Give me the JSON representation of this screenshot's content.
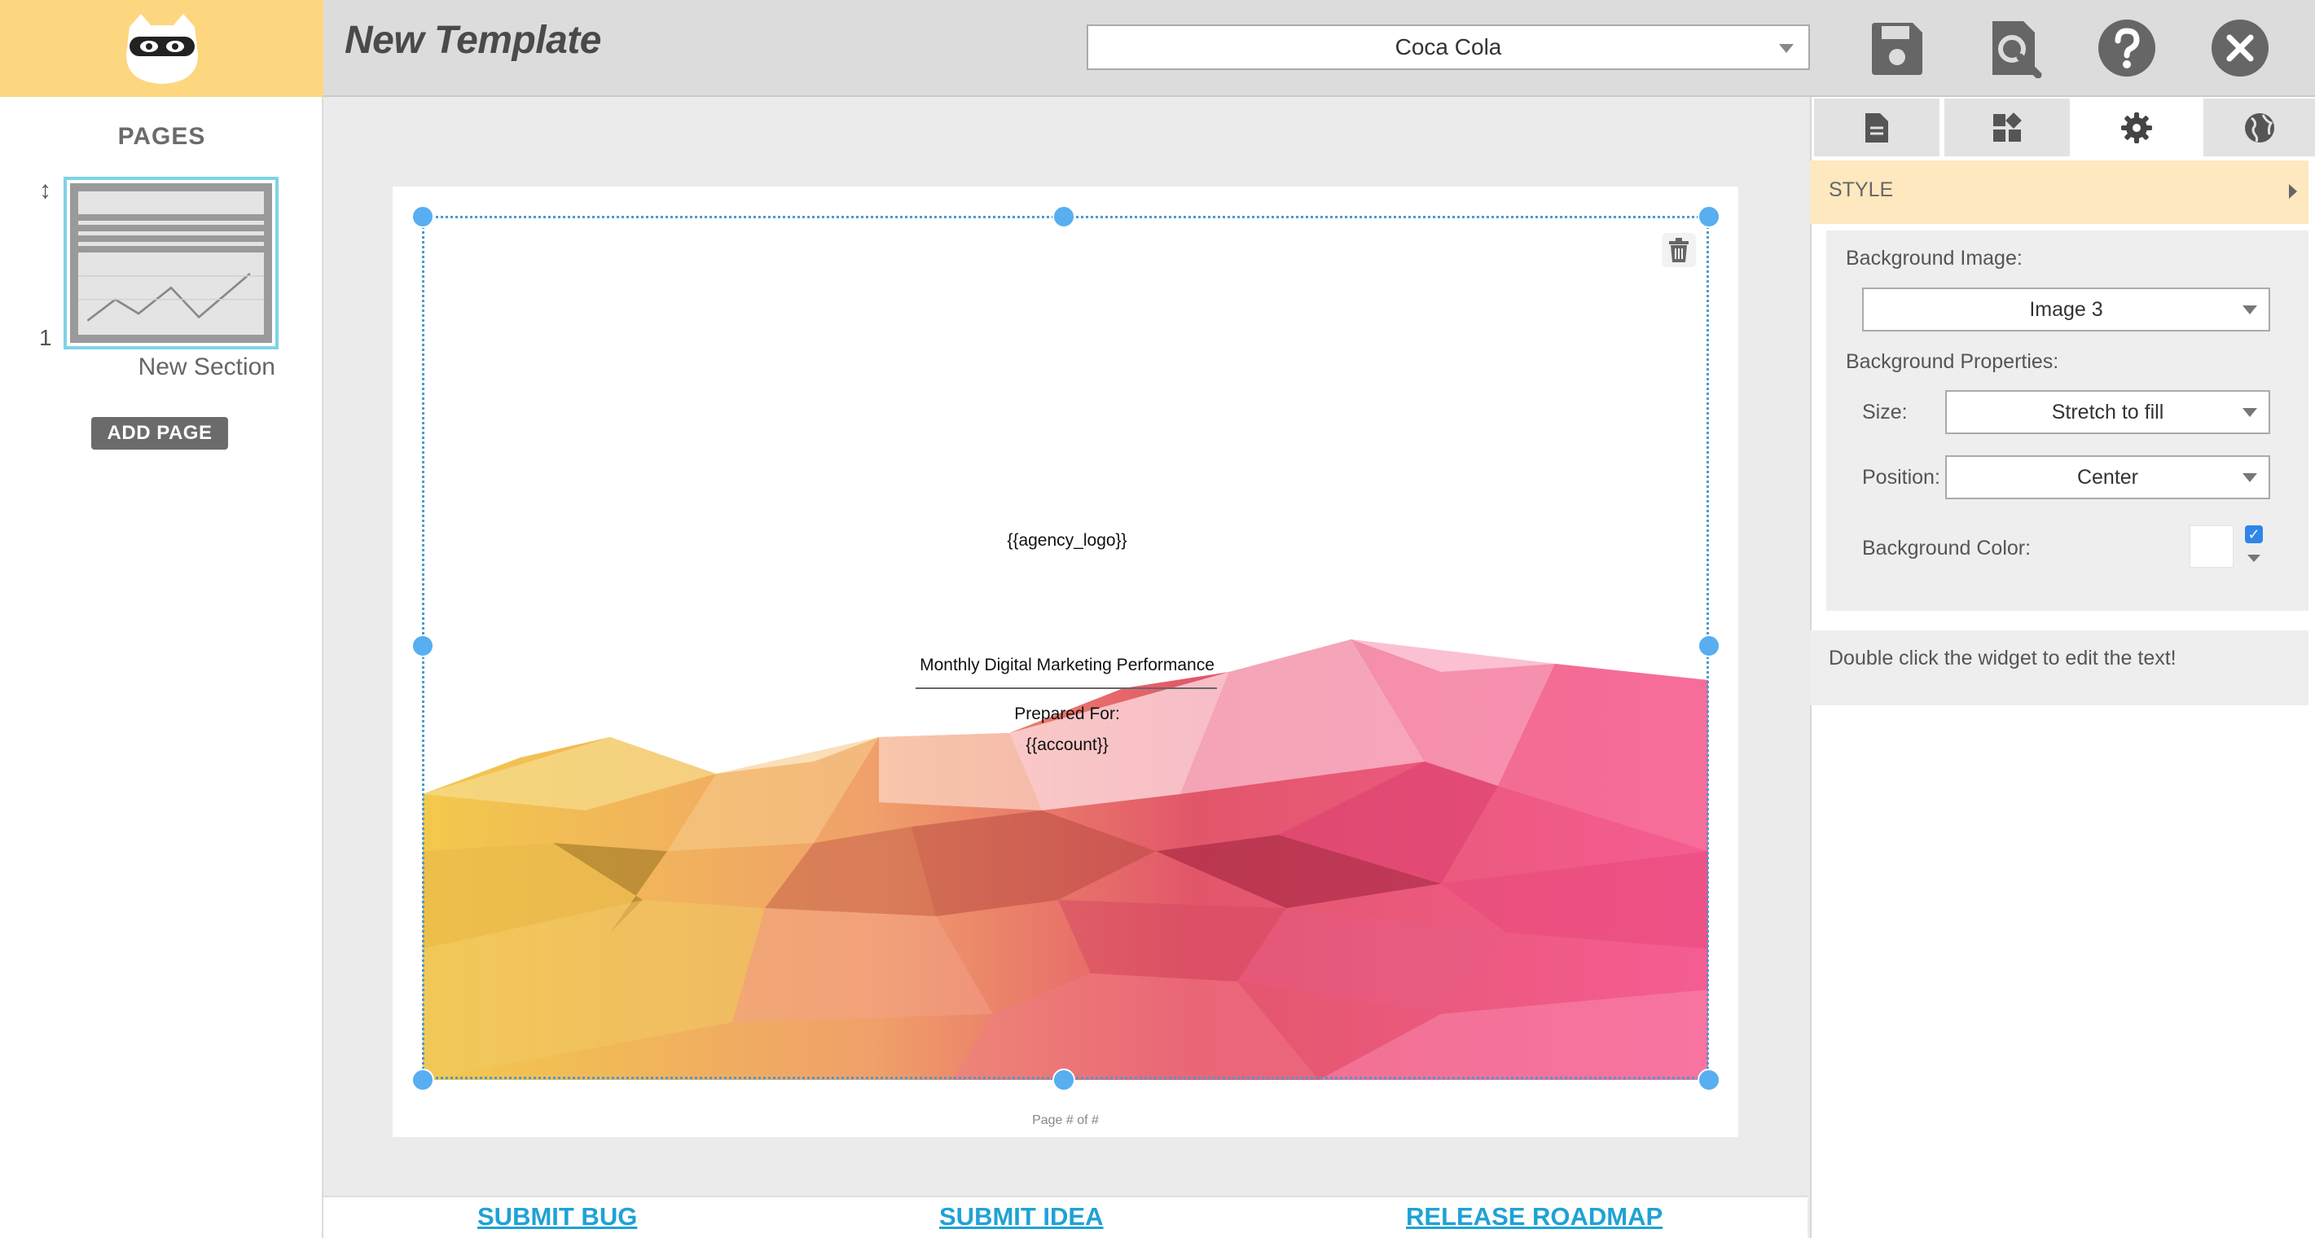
{
  "header": {
    "title": "New Template",
    "client_selector": {
      "value": "Coca Cola"
    },
    "icons": [
      "save-icon",
      "preview-icon",
      "help-icon",
      "close-icon"
    ]
  },
  "sidebar": {
    "title": "PAGES",
    "pages": [
      {
        "number": "1",
        "label": "New Section"
      }
    ],
    "add_page_label": "ADD PAGE"
  },
  "canvas": {
    "agency_logo_placeholder": "{{agency_logo}}",
    "report_title": "Monthly Digital Marketing Performance",
    "prepared_for_label": "Prepared For:",
    "account_placeholder": "{{account}}",
    "page_footer": "Page # of #"
  },
  "bottom_links": {
    "submit_bug": "SUBMIT BUG",
    "submit_idea": "SUBMIT IDEA",
    "release_roadmap": "RELEASE ROADMAP"
  },
  "right_panel": {
    "tabs": [
      {
        "name": "page-tab",
        "icon": "document-icon"
      },
      {
        "name": "widgets-tab",
        "icon": "widgets-icon"
      },
      {
        "name": "settings-tab",
        "icon": "gear-icon",
        "active": true
      },
      {
        "name": "globe-tab",
        "icon": "globe-icon"
      }
    ],
    "section_title": "STYLE",
    "background_image_label": "Background Image:",
    "background_image_value": "Image 3",
    "background_properties_label": "Background Properties:",
    "size_label": "Size:",
    "size_value": "Stretch to fill",
    "position_label": "Position:",
    "position_value": "Center",
    "background_color_label": "Background Color:",
    "background_color_checked": true,
    "hint": "Double click the widget to edit the text!"
  },
  "colors": {
    "brand_yellow": "#fdd77f",
    "selection_blue": "#57aef0",
    "link_blue": "#1fa2d4",
    "style_header": "#fde8bf"
  }
}
